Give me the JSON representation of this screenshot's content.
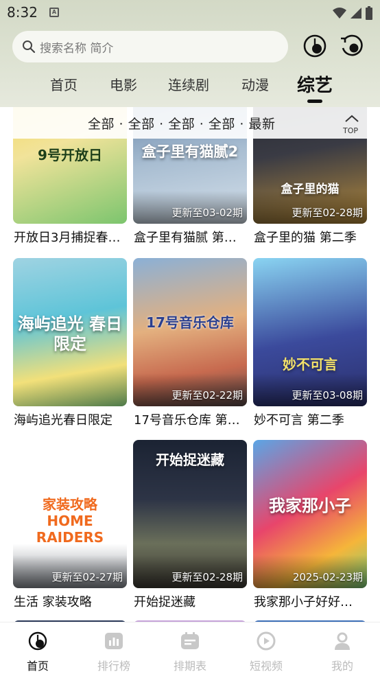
{
  "status_bar": {
    "time": "8:32",
    "app_icon": "A"
  },
  "search": {
    "placeholder": "搜索名称 简介"
  },
  "header_icons": [
    "history-icon",
    "refresh-icon"
  ],
  "nav_tabs": [
    "首页",
    "电影",
    "连续剧",
    "动漫",
    "综艺"
  ],
  "active_nav": "综艺",
  "filter": {
    "label": "全部 · 全部 · 全部 · 全部 · 最新",
    "top_label": "TOP"
  },
  "cards": [
    {
      "title": "开放日3月捕捉春…",
      "badge": "",
      "mark": "9号开放日",
      "colors": [
        "#f6d54c",
        "#7cc56e"
      ]
    },
    {
      "title": "盒子里有猫腻 第…",
      "badge": "更新至03-02期",
      "mark": "盒子里有猫腻2",
      "colors": [
        "#6c8fb4",
        "#c9d6e3"
      ]
    },
    {
      "title": "盒子里的猫 第二季",
      "badge": "更新至02-28期",
      "mark": "盒子里的猫",
      "colors": [
        "#2a2d36",
        "#b58a3a"
      ]
    },
    {
      "title": "海屿追光春日限定",
      "badge": "",
      "mark": "海屿追光 春日限定",
      "colors": [
        "#5ec4d8",
        "#f2e07a"
      ]
    },
    {
      "title": "17号音乐仓库 第…",
      "badge": "更新至02-22期",
      "mark": "17号音乐仓库",
      "colors": [
        "#e3b07f",
        "#8bb0d6"
      ]
    },
    {
      "title": "妙不可言 第二季",
      "badge": "更新至03-08期",
      "mark": "妙不可言",
      "colors": [
        "#3b4a9c",
        "#8ad4f2"
      ]
    },
    {
      "title": "生活 家装攻略",
      "badge": "更新至02-27期",
      "mark": "家装攻略 HOME RAIDERS",
      "colors": [
        "#ffffff",
        "#e8eef5"
      ]
    },
    {
      "title": "开始捉迷藏",
      "badge": "更新至02-28期",
      "mark": "开始捉迷藏",
      "colors": [
        "#1b2333",
        "#6a6f5a"
      ]
    },
    {
      "title": "我家那小子好好…",
      "badge": "2025-02-23期",
      "mark": "我家那小子",
      "colors": [
        "#e8456b",
        "#5aa6e6"
      ]
    }
  ],
  "tabbar": [
    {
      "label": "首页",
      "icon": "home-icon"
    },
    {
      "label": "排行榜",
      "icon": "chart-icon"
    },
    {
      "label": "排期表",
      "icon": "calendar-icon"
    },
    {
      "label": "短视频",
      "icon": "video-icon"
    },
    {
      "label": "我的",
      "icon": "profile-icon"
    }
  ],
  "active_tab": "首页"
}
